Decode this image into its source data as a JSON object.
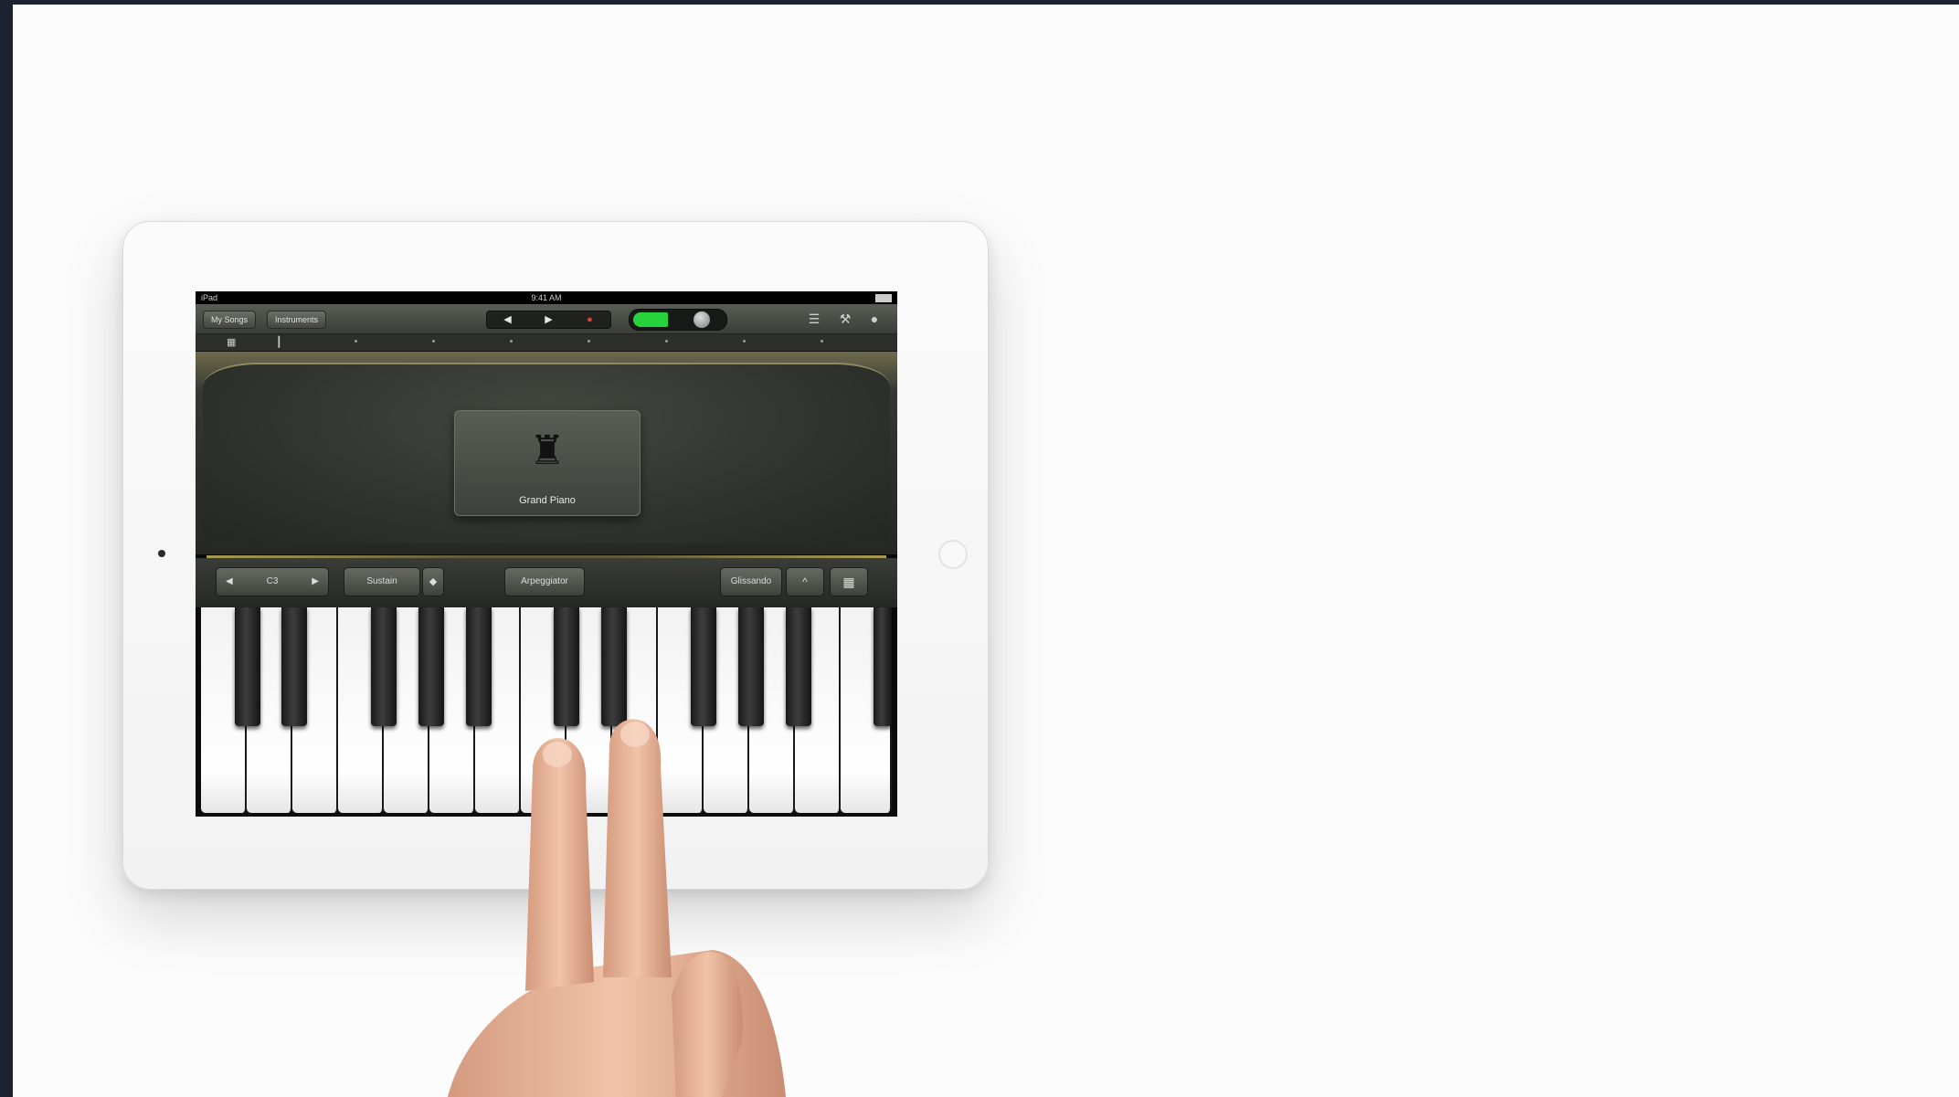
{
  "device": {
    "status_bar": {
      "carrier": "iPad",
      "time": "9:41 AM"
    },
    "toolbar": {
      "my_songs_label": "My Songs",
      "instruments_label": "Instruments",
      "rewind_icon": "rewind-icon",
      "play_icon": "play-icon",
      "record_icon": "record-icon",
      "mixer_icon": "mixer-icon",
      "settings_icon": "wrench-icon",
      "help_icon": "help-icon"
    },
    "instrument": {
      "name": "Grand Piano",
      "icon": "grand-piano-icon"
    },
    "controls": {
      "octave_down": "◀",
      "octave_value": "C3",
      "octave_up": "▶",
      "sustain_label": "Sustain",
      "arpeggiator_label": "Arpeggiator",
      "glissando_label": "Glissando",
      "scale_icon": "scale-icon",
      "keyboard_icon": "keyboard-icon"
    }
  },
  "colors": {
    "background": "#fcfcfc",
    "side_strip": "#1d2130",
    "lcd_green": "#27d33d",
    "record_red": "#e23b3b"
  }
}
